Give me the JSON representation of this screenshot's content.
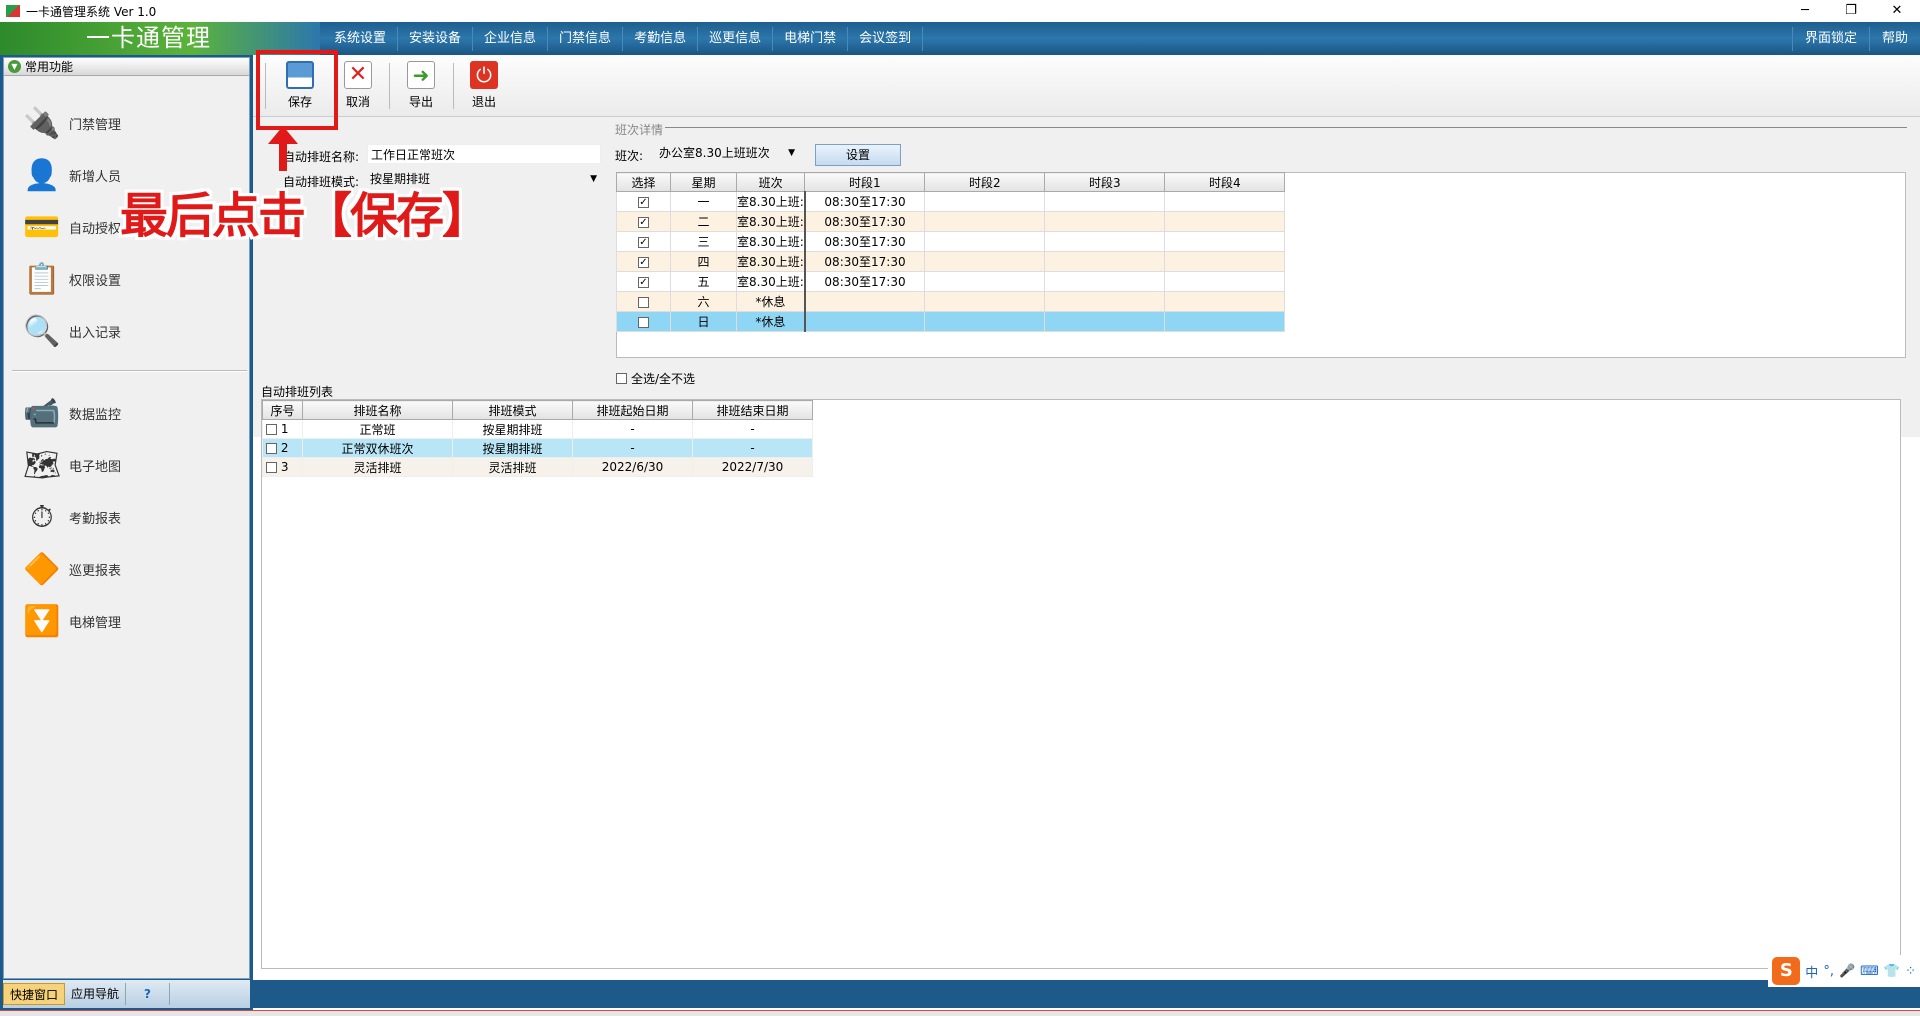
{
  "window": {
    "title": "一卡通管理系统 Ver 1.0",
    "min": "─",
    "max": "❐",
    "close": "✕"
  },
  "app": {
    "logo": "一卡通管理"
  },
  "menu": [
    "系统设置",
    "安装设备",
    "企业信息",
    "门禁信息",
    "考勤信息",
    "巡更信息",
    "电梯门禁",
    "会议签到"
  ],
  "menu_right": [
    "界面锁定",
    "帮助"
  ],
  "sidebar": {
    "header": "常用功能",
    "items": [
      {
        "label": "门禁管理",
        "icon": "door-access-icon"
      },
      {
        "label": "新增人员",
        "icon": "person-icon"
      },
      {
        "label": "自动授权",
        "icon": "card-icon"
      },
      {
        "label": "权限设置",
        "icon": "permission-icon"
      },
      {
        "label": "出入记录",
        "icon": "magnifier-icon"
      },
      {
        "label": "数据监控",
        "icon": "camera-icon"
      },
      {
        "label": "电子地图",
        "icon": "map-icon"
      },
      {
        "label": "考勤报表",
        "icon": "clock-icon"
      },
      {
        "label": "巡更报表",
        "icon": "patrol-icon"
      },
      {
        "label": "电梯管理",
        "icon": "elevator-icon"
      }
    ],
    "footer": [
      "快捷窗口",
      "应用导航",
      "?"
    ]
  },
  "toolbar": {
    "save": "保存",
    "cancel": "取消",
    "export": "导出",
    "exit": "退出"
  },
  "form": {
    "name_label": "自动排班名称:",
    "name_value": "工作日正常班次",
    "mode_label": "自动排班模式:",
    "mode_value": "按星期排班",
    "group_title": "班次详情",
    "shift_label": "班次:",
    "shift_value": "办公室8.30上班班次",
    "set_button": "设置",
    "select_all": "全选/全不选"
  },
  "schedule": {
    "headers": [
      "选择",
      "星期",
      "班次",
      "时段1",
      "时段2",
      "时段3",
      "时段4"
    ],
    "rows": [
      {
        "checked": true,
        "day": "一",
        "shift": "室8.30上班:",
        "t1": "08:30至17:30"
      },
      {
        "checked": true,
        "day": "二",
        "shift": "室8.30上班:",
        "t1": "08:30至17:30"
      },
      {
        "checked": true,
        "day": "三",
        "shift": "室8.30上班:",
        "t1": "08:30至17:30"
      },
      {
        "checked": true,
        "day": "四",
        "shift": "室8.30上班:",
        "t1": "08:30至17:30"
      },
      {
        "checked": true,
        "day": "五",
        "shift": "室8.30上班:",
        "t1": "08:30至17:30"
      },
      {
        "checked": false,
        "day": "六",
        "shift": "*休息",
        "t1": ""
      },
      {
        "checked": false,
        "day": "日",
        "shift": "*休息",
        "t1": ""
      }
    ]
  },
  "list": {
    "title": "自动排班列表",
    "headers": [
      "序号",
      "排班名称",
      "排班模式",
      "排班起始日期",
      "排班结束日期"
    ],
    "rows": [
      {
        "no": "1",
        "name": "正常班",
        "mode": "按星期排班",
        "start": "-",
        "end": "-"
      },
      {
        "no": "2",
        "name": "正常双休班次",
        "mode": "按星期排班",
        "start": "-",
        "end": "-"
      },
      {
        "no": "3",
        "name": "灵活排班",
        "mode": "灵活排班",
        "start": "2022/6/30",
        "end": "2022/7/30"
      }
    ]
  },
  "annotation": {
    "text": "最后点击【保存】",
    "color": "#e01919"
  },
  "ime": {
    "logo": "S",
    "items": [
      "中",
      "°,",
      "🎤",
      "⌨",
      "👕",
      "⁘"
    ]
  }
}
